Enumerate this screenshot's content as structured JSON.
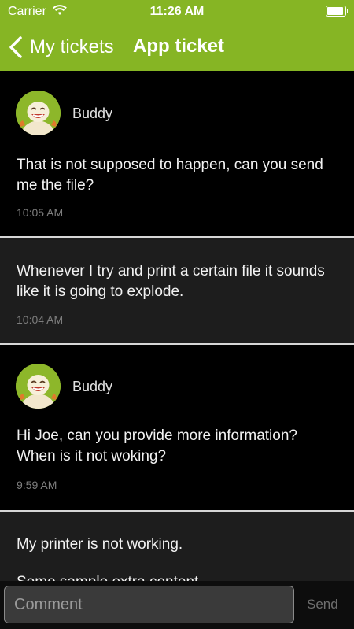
{
  "status_bar": {
    "carrier": "Carrier",
    "time": "11:26 AM"
  },
  "nav": {
    "back_label": "My tickets",
    "title": "App ticket"
  },
  "messages": [
    {
      "author": "Buddy",
      "text": "That is not supposed to happen, can you send me the file?",
      "time": "10:05 AM"
    },
    {
      "text": "Whenever I try and print a certain file it sounds like it is going to explode.",
      "time": "10:04 AM"
    },
    {
      "author": "Buddy",
      "text": "Hi Joe, can you provide more information? When is it not woking?",
      "time": "9:59 AM"
    },
    {
      "text": "My printer is not working.",
      "text2": "Some sample extra content"
    }
  ],
  "composer": {
    "placeholder": "Comment",
    "send_label": "Send"
  },
  "colors": {
    "accent": "#86b524",
    "support_bg": "#000000",
    "user_bg": "#1d1d1d"
  }
}
